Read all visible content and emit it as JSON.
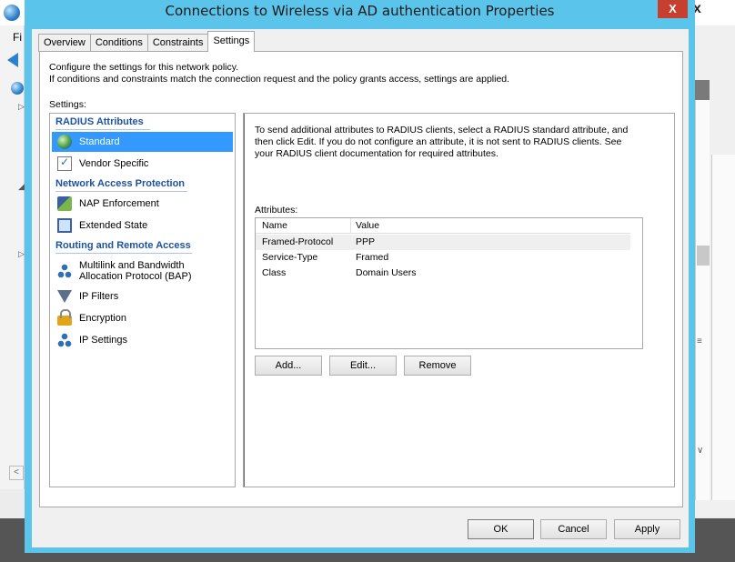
{
  "background": {
    "menu_text": "Fi",
    "scroll_left_glyph": "<",
    "tick_glyph": "▷",
    "tick_glyph_small": "◢",
    "right_close_glyph": "x",
    "scroll_grip_glyph": "≡",
    "scroll_down_glyph": "∨"
  },
  "dialog": {
    "title": "Connections to Wireless via AD authentication Properties",
    "close_glyph": "X",
    "tabs": [
      {
        "label": "Overview"
      },
      {
        "label": "Conditions"
      },
      {
        "label": "Constraints"
      },
      {
        "label": "Settings"
      }
    ],
    "description_line1": "Configure the settings for this network policy.",
    "description_line2": "If conditions and constraints match the connection request and the policy grants access, settings are applied.",
    "settings_label": "Settings:",
    "groups": {
      "radius": "RADIUS Attributes",
      "nap": "Network Access Protection",
      "routing": "Routing and Remote Access"
    },
    "items": {
      "standard": "Standard",
      "vendor_specific": "Vendor Specific",
      "nap_enforcement": "NAP Enforcement",
      "extended_state": "Extended State",
      "multilink_1": "Multilink and Bandwidth",
      "multilink_2": "Allocation Protocol (BAP)",
      "ip_filters": "IP Filters",
      "encryption": "Encryption",
      "ip_settings": "IP Settings"
    },
    "right_description_1": "To send additional attributes to RADIUS clients, select a RADIUS standard attribute, and",
    "right_description_2": "then click Edit. If you do not configure an attribute, it is not sent to RADIUS clients. See",
    "right_description_3": "your RADIUS client documentation for required attributes.",
    "attributes_label": "Attributes:",
    "columns": {
      "name": "Name",
      "value": "Value"
    },
    "rows": [
      {
        "name": "Framed-Protocol",
        "value": "PPP"
      },
      {
        "name": "Service-Type",
        "value": "Framed"
      },
      {
        "name": "Class",
        "value": "Domain Users"
      }
    ],
    "buttons": {
      "add": "Add...",
      "edit": "Edit...",
      "remove": "Remove",
      "ok": "OK",
      "cancel": "Cancel",
      "apply": "Apply"
    }
  }
}
